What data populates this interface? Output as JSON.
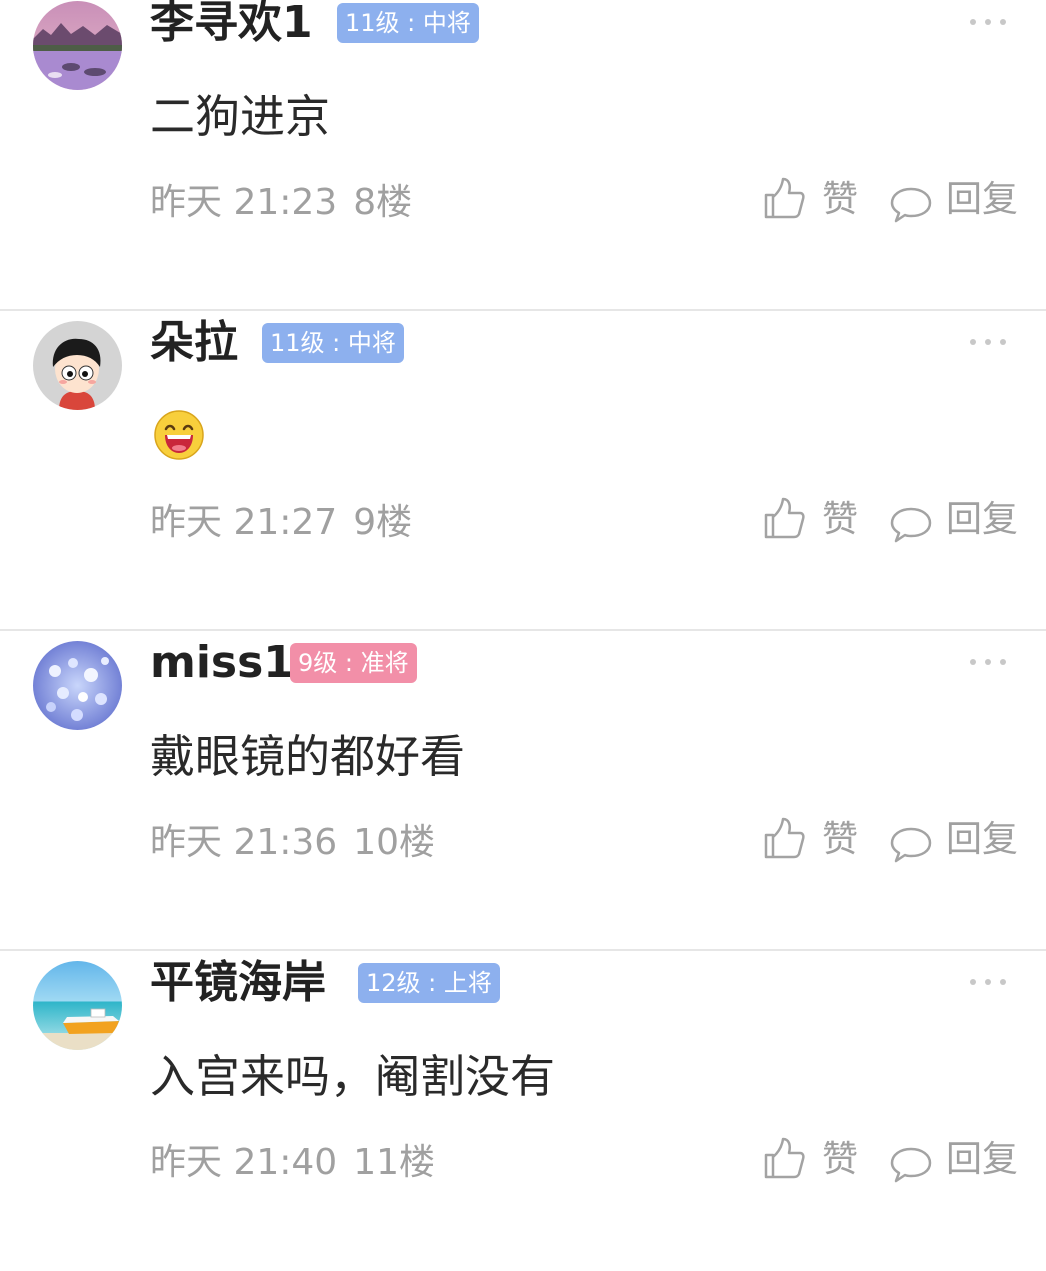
{
  "actions": {
    "like_label": "赞",
    "reply_label": "回复"
  },
  "colors": {
    "badge_blue": "#8db0ee",
    "badge_pink": "#f28fa8",
    "meta_text": "#a0a0a0",
    "divider": "#e6e6e6"
  },
  "posts": [
    {
      "username": "李寻欢1",
      "badge": "11级 : 中将",
      "badge_color": "blue",
      "avatar_icon": "lake-landscape-avatar",
      "content": "二狗进京",
      "time": "昨天 21:23",
      "floor": "8楼"
    },
    {
      "username": "朵拉",
      "badge": "11级 : 中将",
      "badge_color": "blue",
      "avatar_icon": "cartoon-boy-avatar",
      "content": "",
      "content_emoji": "laughing-face-emoji",
      "time": "昨天 21:27",
      "floor": "9楼"
    },
    {
      "username": "miss1",
      "badge": "9级 : 准将",
      "badge_color": "pink",
      "avatar_icon": "blue-flowers-avatar",
      "content": "戴眼镜的都好看",
      "time": "昨天 21:36",
      "floor": "10楼"
    },
    {
      "username": "平镜海岸",
      "badge": "12级 : 上将",
      "badge_color": "blue",
      "avatar_icon": "beach-boat-avatar",
      "content": "入宫来吗，阉割没有",
      "time": "昨天 21:40",
      "floor": "11楼"
    }
  ]
}
